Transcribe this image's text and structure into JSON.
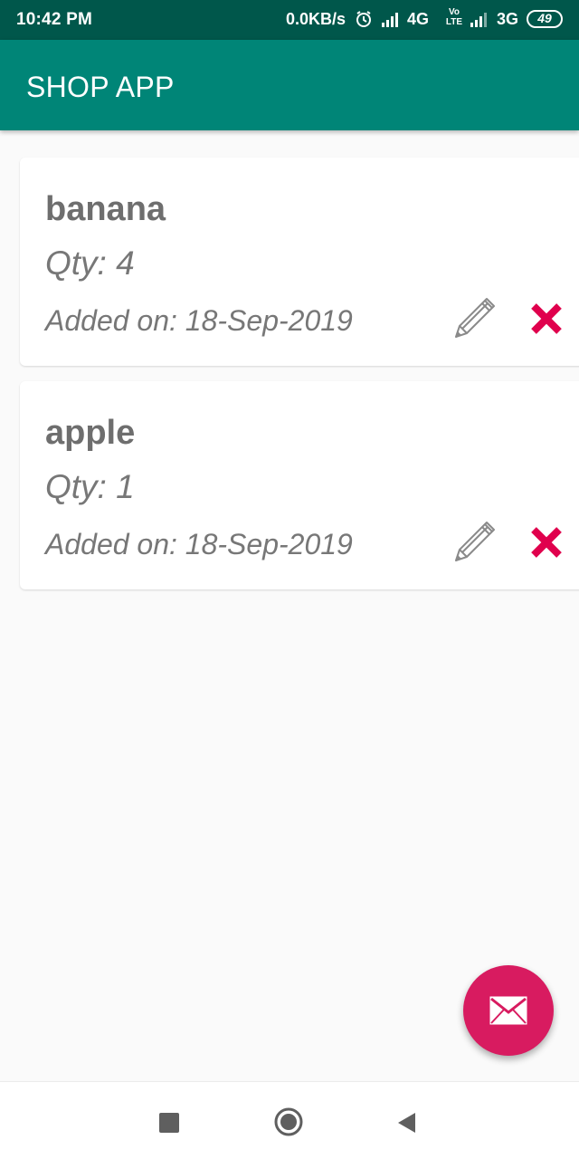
{
  "status_bar": {
    "time": "10:42 PM",
    "net_speed": "0.0KB/s",
    "network_1": "4G",
    "volte": "Vo LTE",
    "network_2": "3G",
    "battery": "49",
    "icons": [
      "alarm-icon",
      "signal-icon",
      "signal-icon",
      "battery-icon"
    ]
  },
  "app_bar": {
    "title": "SHOP APP"
  },
  "items": [
    {
      "name": "banana",
      "qty": "Qty: 4",
      "added": "Added on: 18-Sep-2019",
      "edit_icon": "pencil-icon",
      "delete_icon": "close-icon"
    },
    {
      "name": "apple",
      "qty": "Qty: 1",
      "added": "Added on: 18-Sep-2019",
      "edit_icon": "pencil-icon",
      "delete_icon": "close-icon"
    }
  ],
  "fab": {
    "icon": "envelope-icon",
    "color": "#d81b60"
  },
  "nav_bar": {
    "icons": [
      "recents-square-icon",
      "home-circle-icon",
      "back-triangle-icon"
    ]
  },
  "colors": {
    "status_bar": "#00574b",
    "app_bar": "#008577",
    "delete": "#e0004d",
    "background": "#fafafa"
  }
}
